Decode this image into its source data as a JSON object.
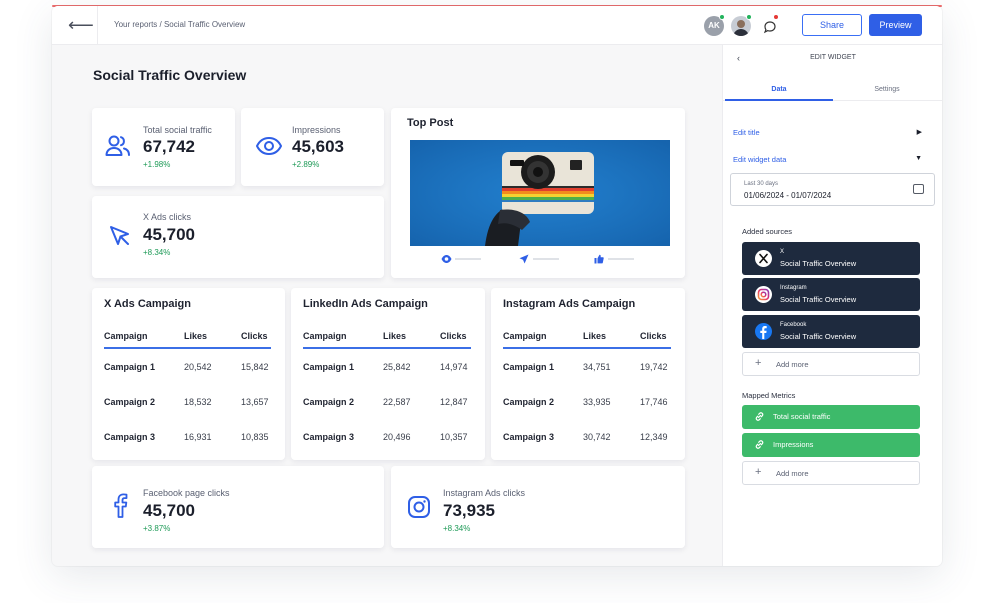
{
  "topbar": {
    "breadcrumb": "Your reports / Social Traffic Overview",
    "avatar_initials": "AK",
    "share_label": "Share",
    "preview_label": "Preview"
  },
  "page": {
    "title": "Social Traffic Overview"
  },
  "stats": {
    "total_social": {
      "label": "Total social traffic",
      "value": "67,742",
      "change": "+1.98%"
    },
    "impressions": {
      "label": "Impressions",
      "value": "45,603",
      "change": "+2.89%"
    },
    "x_ads_clicks": {
      "label": "X Ads clicks",
      "value": "45,700",
      "change": "+8.34%"
    },
    "facebook_clicks": {
      "label": "Facebook page clicks",
      "value": "45,700",
      "change": "+3.87%"
    },
    "instagram_clicks": {
      "label": "Instagram Ads clicks",
      "value": "73,935",
      "change": "+8.34%"
    }
  },
  "top_post": {
    "title": "Top Post"
  },
  "tables": [
    {
      "title": "X Ads Campaign",
      "headers": [
        "Campaign",
        "Likes",
        "Clicks"
      ],
      "rows": [
        [
          "Campaign 1",
          "20,542",
          "15,842"
        ],
        [
          "Campaign 2",
          "18,532",
          "13,657"
        ],
        [
          "Campaign 3",
          "16,931",
          "10,835"
        ]
      ]
    },
    {
      "title": "LinkedIn Ads Campaign",
      "headers": [
        "Campaign",
        "Likes",
        "Clicks"
      ],
      "rows": [
        [
          "Campaign 1",
          "25,842",
          "14,974"
        ],
        [
          "Campaign 2",
          "22,587",
          "12,847"
        ],
        [
          "Campaign 3",
          "20,496",
          "10,357"
        ]
      ]
    },
    {
      "title": "Instagram Ads Campaign",
      "headers": [
        "Campaign",
        "Likes",
        "Clicks"
      ],
      "rows": [
        [
          "Campaign 1",
          "34,751",
          "19,742"
        ],
        [
          "Campaign 2",
          "33,935",
          "17,746"
        ],
        [
          "Campaign 3",
          "30,742",
          "12,349"
        ]
      ]
    }
  ],
  "sidebar": {
    "header": "EDIT WIDGET",
    "tabs": [
      "Data",
      "Settings"
    ],
    "edit_title": "Edit title",
    "edit_data": "Edit widget data",
    "date_label": "Last 30 days",
    "date_value": "01/06/2024 - 01/07/2024",
    "added_sources_label": "Added sources",
    "sources": [
      {
        "network": "X",
        "name": "Social Traffic Overview"
      },
      {
        "network": "Instagram",
        "name": "Social Traffic Overview"
      },
      {
        "network": "Facebook",
        "name": "Social Traffic Overview"
      }
    ],
    "add_more": "Add more",
    "mapped_metrics_label": "Mapped Metrics",
    "metrics": [
      "Total social traffic",
      "Impressions"
    ]
  },
  "colors": {
    "accent": "#2f5fe6",
    "positive": "#1e9a57",
    "source_bg": "#1e2a3e",
    "metric_bg": "#3dba6a"
  }
}
